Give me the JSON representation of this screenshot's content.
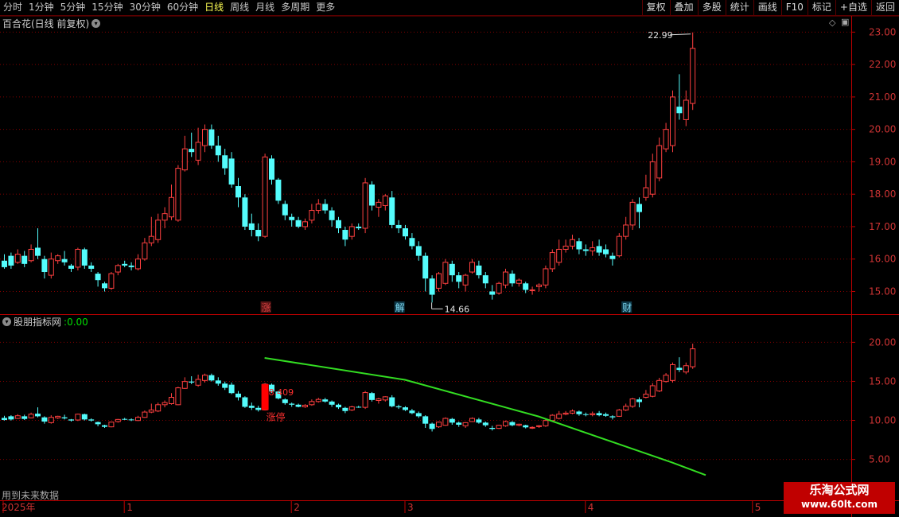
{
  "toolbar": {
    "periods": [
      {
        "label": "分时",
        "active": false
      },
      {
        "label": "1分钟",
        "active": false
      },
      {
        "label": "5分钟",
        "active": false
      },
      {
        "label": "15分钟",
        "active": false
      },
      {
        "label": "30分钟",
        "active": false
      },
      {
        "label": "60分钟",
        "active": false
      },
      {
        "label": "日线",
        "active": true
      },
      {
        "label": "周线",
        "active": false
      },
      {
        "label": "月线",
        "active": false
      },
      {
        "label": "多周期",
        "active": false
      },
      {
        "label": "更多",
        "active": false
      }
    ],
    "buttons": [
      "复权",
      "叠加",
      "多股",
      "统计",
      "画线",
      "F10",
      "标记",
      "+自选",
      "返回"
    ]
  },
  "main_panel": {
    "title": "百合花(日线 前复权)",
    "high_label": "22.99",
    "low_label": "14.66",
    "event_tags": [
      {
        "text": "涨",
        "color": "#d04040",
        "bg": "#5a1515",
        "index": 39
      },
      {
        "text": "解",
        "color": "#7fd8f0",
        "bg": "#0f3a4a",
        "index": 59
      },
      {
        "text": "财",
        "color": "#7fd8f0",
        "bg": "#0f3a4a",
        "index": 93
      }
    ]
  },
  "indicator_panel": {
    "title": "股朋指标网",
    "value": "0.00",
    "annotation_value": "8.409",
    "annotation_label": "涨停"
  },
  "footer": {
    "note": "用到未来数据",
    "year_label": "2025年",
    "month_labels": [
      "1",
      "2",
      "3",
      "4",
      "5"
    ]
  },
  "watermark": {
    "line1": "乐淘公式网",
    "line2": "www.60lt.com"
  },
  "colors": {
    "up": "#ff4040",
    "down": "#54fcfc",
    "green_line": "#33dd22",
    "grid": "#800000",
    "axis_text": "#cc3333"
  },
  "chart_data": [
    {
      "type": "candlestick",
      "title": "百合花(日线 前复权)",
      "y_ticks": [
        15.0,
        16.0,
        17.0,
        18.0,
        19.0,
        20.0,
        21.0,
        22.0,
        23.0
      ],
      "ylim": [
        14.3,
        23.5
      ],
      "candles": [
        [
          15.95,
          15.75,
          16.15,
          15.7
        ],
        [
          16.1,
          15.8,
          16.2,
          15.7
        ],
        [
          15.9,
          16.15,
          16.3,
          15.85
        ],
        [
          16.1,
          15.85,
          16.25,
          15.75
        ],
        [
          15.95,
          16.3,
          16.45,
          15.9
        ],
        [
          16.35,
          16.1,
          16.95,
          16.0
        ],
        [
          16.0,
          15.6,
          16.1,
          15.4
        ],
        [
          15.5,
          16.0,
          16.2,
          15.4
        ],
        [
          15.95,
          16.1,
          16.15,
          15.85
        ],
        [
          16.0,
          15.9,
          16.25,
          15.8
        ],
        [
          15.8,
          15.7,
          15.85,
          15.6
        ],
        [
          15.75,
          16.3,
          16.35,
          15.65
        ],
        [
          16.3,
          15.8,
          16.35,
          15.7
        ],
        [
          15.8,
          15.7,
          15.9,
          15.6
        ],
        [
          15.55,
          15.35,
          15.6,
          15.15
        ],
        [
          15.25,
          15.1,
          15.3,
          15.0
        ],
        [
          15.1,
          15.55,
          15.6,
          15.05
        ],
        [
          15.6,
          15.8,
          15.85,
          15.5
        ],
        [
          15.85,
          15.8,
          15.95,
          15.75
        ],
        [
          15.8,
          15.75,
          15.9,
          15.65
        ],
        [
          15.7,
          16.0,
          16.15,
          15.65
        ],
        [
          16.0,
          16.5,
          16.65,
          15.95
        ],
        [
          16.5,
          16.7,
          17.3,
          16.4
        ],
        [
          16.6,
          17.2,
          17.4,
          16.5
        ],
        [
          17.2,
          17.4,
          17.6,
          16.95
        ],
        [
          17.3,
          17.9,
          18.3,
          17.2
        ],
        [
          17.2,
          18.8,
          18.9,
          17.15
        ],
        [
          18.75,
          19.4,
          19.8,
          18.7
        ],
        [
          19.4,
          19.3,
          19.9,
          19.15
        ],
        [
          19.05,
          19.6,
          20.05,
          18.9
        ],
        [
          19.5,
          20.0,
          20.15,
          19.3
        ],
        [
          20.0,
          19.5,
          20.15,
          19.4
        ],
        [
          19.5,
          19.2,
          19.8,
          19.0
        ],
        [
          19.2,
          18.8,
          19.4,
          18.6
        ],
        [
          19.1,
          18.3,
          19.3,
          18.2
        ],
        [
          18.25,
          17.9,
          18.5,
          17.6
        ],
        [
          17.9,
          17.0,
          18.0,
          16.9
        ],
        [
          17.1,
          16.9,
          17.4,
          16.7
        ],
        [
          16.9,
          16.7,
          17.1,
          16.55
        ],
        [
          16.7,
          19.15,
          19.25,
          16.65
        ],
        [
          19.1,
          18.45,
          19.2,
          18.3
        ],
        [
          18.45,
          17.8,
          18.5,
          17.7
        ],
        [
          17.7,
          17.35,
          17.8,
          17.2
        ],
        [
          17.3,
          17.2,
          17.4,
          17.0
        ],
        [
          17.2,
          17.0,
          17.3,
          16.95
        ],
        [
          17.0,
          17.15,
          17.25,
          16.9
        ],
        [
          17.2,
          17.5,
          17.7,
          17.1
        ],
        [
          17.5,
          17.7,
          17.85,
          17.4
        ],
        [
          17.7,
          17.5,
          17.85,
          17.4
        ],
        [
          17.5,
          17.2,
          17.6,
          17.0
        ],
        [
          17.2,
          16.95,
          17.3,
          16.8
        ],
        [
          16.9,
          16.6,
          17.0,
          16.4
        ],
        [
          16.7,
          17.0,
          17.1,
          16.6
        ],
        [
          17.0,
          16.95,
          17.1,
          16.9
        ],
        [
          16.95,
          18.35,
          18.5,
          16.8
        ],
        [
          18.3,
          17.65,
          18.4,
          17.5
        ],
        [
          17.6,
          17.75,
          17.85,
          17.3
        ],
        [
          17.65,
          17.95,
          18.0,
          17.5
        ],
        [
          17.9,
          17.05,
          18.1,
          16.95
        ],
        [
          17.05,
          16.95,
          17.2,
          16.8
        ],
        [
          16.95,
          16.7,
          17.05,
          16.6
        ],
        [
          16.65,
          16.4,
          16.8,
          16.3
        ],
        [
          16.4,
          16.1,
          16.55,
          15.95
        ],
        [
          16.1,
          15.4,
          16.2,
          15.0
        ],
        [
          15.4,
          14.9,
          15.5,
          14.66
        ],
        [
          15.1,
          15.55,
          15.6,
          15.0
        ],
        [
          15.25,
          15.9,
          16.0,
          15.2
        ],
        [
          15.85,
          15.5,
          15.95,
          15.3
        ],
        [
          15.5,
          15.3,
          15.6,
          15.1
        ],
        [
          15.2,
          15.5,
          15.55,
          15.0
        ],
        [
          15.6,
          15.9,
          16.0,
          15.55
        ],
        [
          15.8,
          15.5,
          15.95,
          15.4
        ],
        [
          15.5,
          15.25,
          15.6,
          15.1
        ],
        [
          15.0,
          14.9,
          15.2,
          14.75
        ],
        [
          14.95,
          15.25,
          15.3,
          14.9
        ],
        [
          15.2,
          15.6,
          15.7,
          15.1
        ],
        [
          15.55,
          15.25,
          15.65,
          15.15
        ],
        [
          15.25,
          15.35,
          15.4,
          15.15
        ],
        [
          15.25,
          15.05,
          15.3,
          14.95
        ],
        [
          15.05,
          15.05,
          15.15,
          14.9
        ],
        [
          15.15,
          15.2,
          15.25,
          15.0
        ],
        [
          15.2,
          15.7,
          15.8,
          15.1
        ],
        [
          15.7,
          16.2,
          16.3,
          15.6
        ],
        [
          15.9,
          16.3,
          16.6,
          15.8
        ],
        [
          16.3,
          16.4,
          16.6,
          16.2
        ],
        [
          16.4,
          16.6,
          16.75,
          16.3
        ],
        [
          16.55,
          16.3,
          16.65,
          16.15
        ],
        [
          16.3,
          16.25,
          16.45,
          16.1
        ],
        [
          16.25,
          16.35,
          16.55,
          16.1
        ],
        [
          16.4,
          16.2,
          16.6,
          16.1
        ],
        [
          16.3,
          16.15,
          16.45,
          16.05
        ],
        [
          16.1,
          16.0,
          16.2,
          15.8
        ],
        [
          16.1,
          16.7,
          16.8,
          16.05
        ],
        [
          16.7,
          17.05,
          17.3,
          16.6
        ],
        [
          17.05,
          17.75,
          17.85,
          16.9
        ],
        [
          17.7,
          17.45,
          17.9,
          16.95
        ],
        [
          17.9,
          18.2,
          18.6,
          17.8
        ],
        [
          18.0,
          19.0,
          19.25,
          17.9
        ],
        [
          18.5,
          19.5,
          19.75,
          18.4
        ],
        [
          19.4,
          20.0,
          20.2,
          19.3
        ],
        [
          19.5,
          21.0,
          21.2,
          19.3
        ],
        [
          20.7,
          20.5,
          21.7,
          20.3
        ],
        [
          20.3,
          20.9,
          21.2,
          20.1
        ],
        [
          20.8,
          22.5,
          22.99,
          20.6
        ]
      ]
    },
    {
      "type": "bar",
      "title": "股朋指标网",
      "y_ticks": [
        5.0,
        10.0,
        15.0,
        20.0
      ],
      "ylim": [
        1.5,
        23.5
      ],
      "green_line": [
        {
          "x": 39,
          "y": 18.0
        },
        {
          "x": 60,
          "y": 15.2
        },
        {
          "x": 80,
          "y": 10.5
        },
        {
          "x": 100,
          "y": 4.6
        },
        {
          "x": 105,
          "y": 3.0
        }
      ]
    }
  ]
}
